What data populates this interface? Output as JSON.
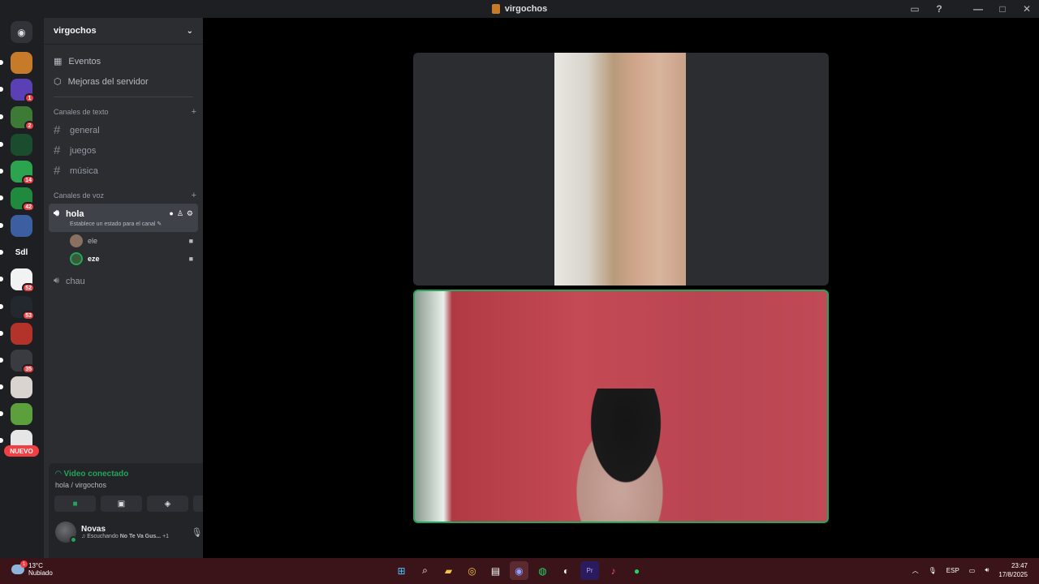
{
  "window": {
    "title": "virgochos"
  },
  "guilds": [
    {
      "badge": "",
      "color": "#c77b2a"
    },
    {
      "badge": "1",
      "color": "#5b3fb5"
    },
    {
      "badge": "2",
      "color": "#3d7a36"
    },
    {
      "badge": "",
      "color": "#1a4d2e"
    },
    {
      "badge": "14",
      "color": "#2ca34f"
    },
    {
      "badge": "42",
      "color": "#1f8a3d"
    },
    {
      "badge": "",
      "color": "#3b5fa0"
    },
    {
      "badge": "",
      "label": "Sdl",
      "color": "#1e1f22"
    },
    {
      "badge": "52",
      "color": "#f2f2f2"
    },
    {
      "badge": "53",
      "color": "#23272e"
    },
    {
      "badge": "",
      "color": "#b3332a"
    },
    {
      "badge": "35",
      "color": "#3a3b40"
    },
    {
      "badge": "",
      "color": "#d9d4cf"
    },
    {
      "badge": "",
      "color": "#5ca03e"
    },
    {
      "badge": "",
      "color": "#e6e6e6"
    }
  ],
  "nuevo_label": "NUEVO",
  "server": {
    "name": "virgochos",
    "events": "Eventos",
    "boosts": "Mejoras del servidor",
    "text_category": "Canales de texto",
    "text_channels": [
      "general",
      "juegos",
      "música"
    ],
    "voice_category": "Canales de voz",
    "active_voice": {
      "name": "hola",
      "status_hint": "Establece un estado para el canal"
    },
    "voice_users": [
      {
        "name": "ele"
      },
      {
        "name": "eze"
      }
    ],
    "other_voice": "chau"
  },
  "voice_panel": {
    "status": "Video conectado",
    "location": "hola / virgochos"
  },
  "user": {
    "name": "Novas",
    "status_prefix": "Escuchando",
    "status_song": "No Te Va Gus...",
    "status_extra": "+1"
  },
  "taskbar": {
    "weather_temp": "13°C",
    "weather_desc": "Nubiado",
    "weather_badge": "1",
    "lang": "ESP",
    "time": "23:47",
    "date": "17/8/2025"
  },
  "colors": {
    "green": "#23a55a",
    "red": "#f23f43",
    "bg": "#2b2d31"
  }
}
